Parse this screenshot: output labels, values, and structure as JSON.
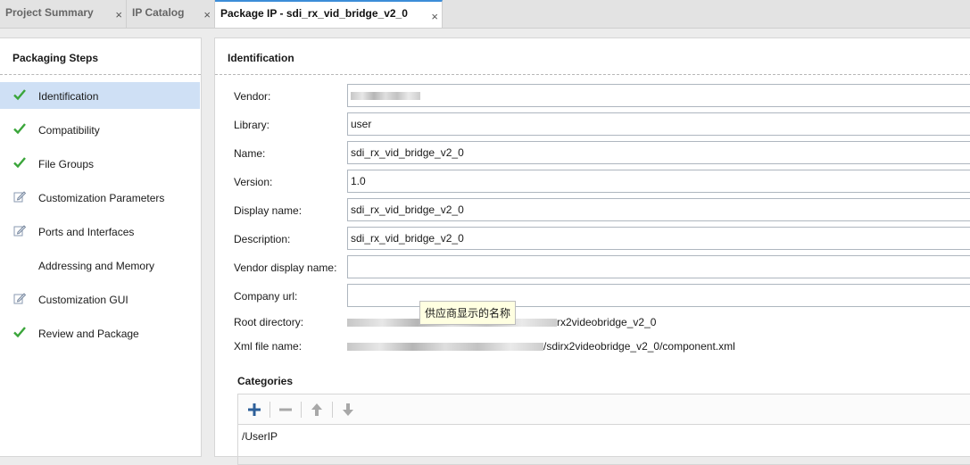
{
  "tabs": [
    {
      "label": "Project Summary",
      "active": false
    },
    {
      "label": "IP Catalog",
      "active": false
    },
    {
      "label": "Package IP - sdi_rx_vid_bridge_v2_0",
      "active": true
    }
  ],
  "close_glyph": "×",
  "packaging": {
    "title": "Packaging Steps",
    "steps": [
      {
        "label": "Identification",
        "icon": "check-icon",
        "selected": true
      },
      {
        "label": "Compatibility",
        "icon": "check-icon",
        "selected": false
      },
      {
        "label": "File Groups",
        "icon": "check-icon",
        "selected": false
      },
      {
        "label": "Customization Parameters",
        "icon": "edit-icon",
        "selected": false
      },
      {
        "label": "Ports and Interfaces",
        "icon": "edit-icon",
        "selected": false
      },
      {
        "label": "Addressing and Memory",
        "icon": "none",
        "selected": false
      },
      {
        "label": "Customization GUI",
        "icon": "edit-icon",
        "selected": false
      },
      {
        "label": "Review and Package",
        "icon": "check-icon",
        "selected": false
      }
    ]
  },
  "identification": {
    "title": "Identification",
    "fields": {
      "vendor": {
        "label": "Vendor:",
        "value": ""
      },
      "library": {
        "label": "Library:",
        "value": "user"
      },
      "name": {
        "label": "Name:",
        "value": "sdi_rx_vid_bridge_v2_0"
      },
      "version": {
        "label": "Version:",
        "value": "1.0"
      },
      "display_name": {
        "label": "Display name:",
        "value": "sdi_rx_vid_bridge_v2_0"
      },
      "description": {
        "label": "Description:",
        "value": "sdi_rx_vid_bridge_v2_0"
      },
      "vendor_display_name": {
        "label": "Vendor display name:",
        "value": ""
      },
      "company_url": {
        "label": "Company url:",
        "value": ""
      },
      "root_directory": {
        "label": "Root directory:",
        "value_suffix": "rx2videobridge_v2_0"
      },
      "xml_file_name": {
        "label": "Xml file name:",
        "value_suffix": "/sdirx2videobridge_v2_0/component.xml"
      }
    },
    "tooltip": "供应商显示的名称"
  },
  "categories": {
    "title": "Categories",
    "toolbar": [
      "add-icon",
      "remove-icon",
      "move-up-icon",
      "move-down-icon"
    ],
    "items": [
      "/UserIP"
    ]
  },
  "colors": {
    "accent": "#3c8dd8",
    "check": "#3aa53a",
    "selected_row": "#cfe0f5"
  }
}
